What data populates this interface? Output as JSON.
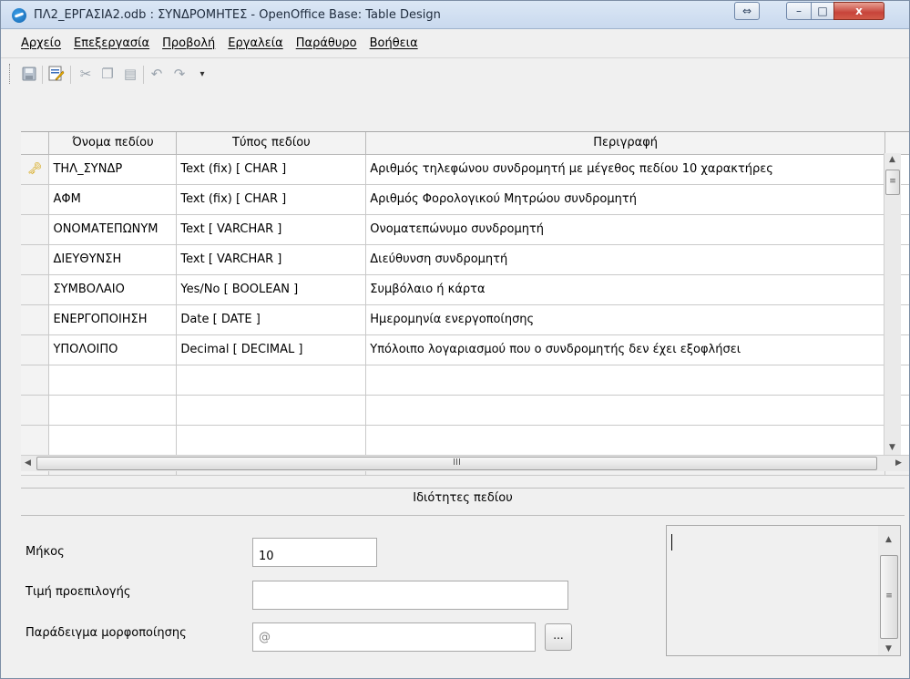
{
  "window": {
    "title": "ΠΛ2_ΕΡΓΑΣΙΑ2.odb : ΣΥΝΔΡΟΜΗΤΕΣ - OpenOffice Base: Table Design",
    "buttons": {
      "restore_alt": "⇔",
      "minimize": "–",
      "maximize": "□",
      "close": "x"
    }
  },
  "menu": [
    "Αρχείο",
    "Επεξεργασία",
    "Προβολή",
    "Εργαλεία",
    "Παράθυρο",
    "Βοήθεια"
  ],
  "toolbar": {
    "icons": [
      "save-icon",
      "edit-icon",
      "cut-icon",
      "copy-icon",
      "paste-icon",
      "undo-icon",
      "redo-icon",
      "toolbar-overflow-icon"
    ]
  },
  "table": {
    "headers": [
      "Όνομα πεδίου",
      "Τύπος πεδίου",
      "Περιγραφή"
    ],
    "rows": [
      {
        "name": "ΤΗΛ_ΣΥΝΔΡ",
        "type": "Text (fix) [ CHAR ]",
        "desc": "Αριθμός τηλεφώνου συνδρομητή με μέγεθος πεδίου 10 χαρακτήρες",
        "primary_key": true
      },
      {
        "name": "ΑΦΜ",
        "type": "Text (fix) [ CHAR ]",
        "desc": "Αριθμός Φορολογικού Μητρώου συνδρομητή"
      },
      {
        "name": "ΟΝΟΜΑΤΕΠΩΝΥΜ",
        "type": "Text [ VARCHAR ]",
        "desc": "Ονοματεπώνυμο συνδρομητή"
      },
      {
        "name": "ΔΙΕΥΘΥΝΣΗ",
        "type": "Text [ VARCHAR ]",
        "desc": "Διεύθυνση συνδρομητή"
      },
      {
        "name": "ΣΥΜΒΟΛΑΙΟ",
        "type": "Yes/No [ BOOLEAN ]",
        "desc": "Συμβόλαιο ή κάρτα"
      },
      {
        "name": "ΕΝΕΡΓΟΠΟΙΗΣΗ",
        "type": "Date [ DATE ]",
        "desc": "Ημερομηνία ενεργοποίησης"
      },
      {
        "name": "ΥΠΟΛΟΙΠΟ",
        "type": "Decimal [ DECIMAL ]",
        "desc": "Υπόλοιπο λογαριασμού που ο συνδρομητής δεν έχει εξοφλήσει"
      }
    ],
    "empty_rows": 4
  },
  "props": {
    "title": "Ιδιότητες πεδίου",
    "length_label": "Μήκος",
    "length_value": "10",
    "default_label": "Τιμή προεπιλογής",
    "default_value": "",
    "format_label": "Παράδειγμα μορφοποίησης",
    "format_value": "@",
    "format_button": "..."
  },
  "scroll": {
    "hscroll_glyph": "III",
    "thumb_glyph": "≡"
  }
}
